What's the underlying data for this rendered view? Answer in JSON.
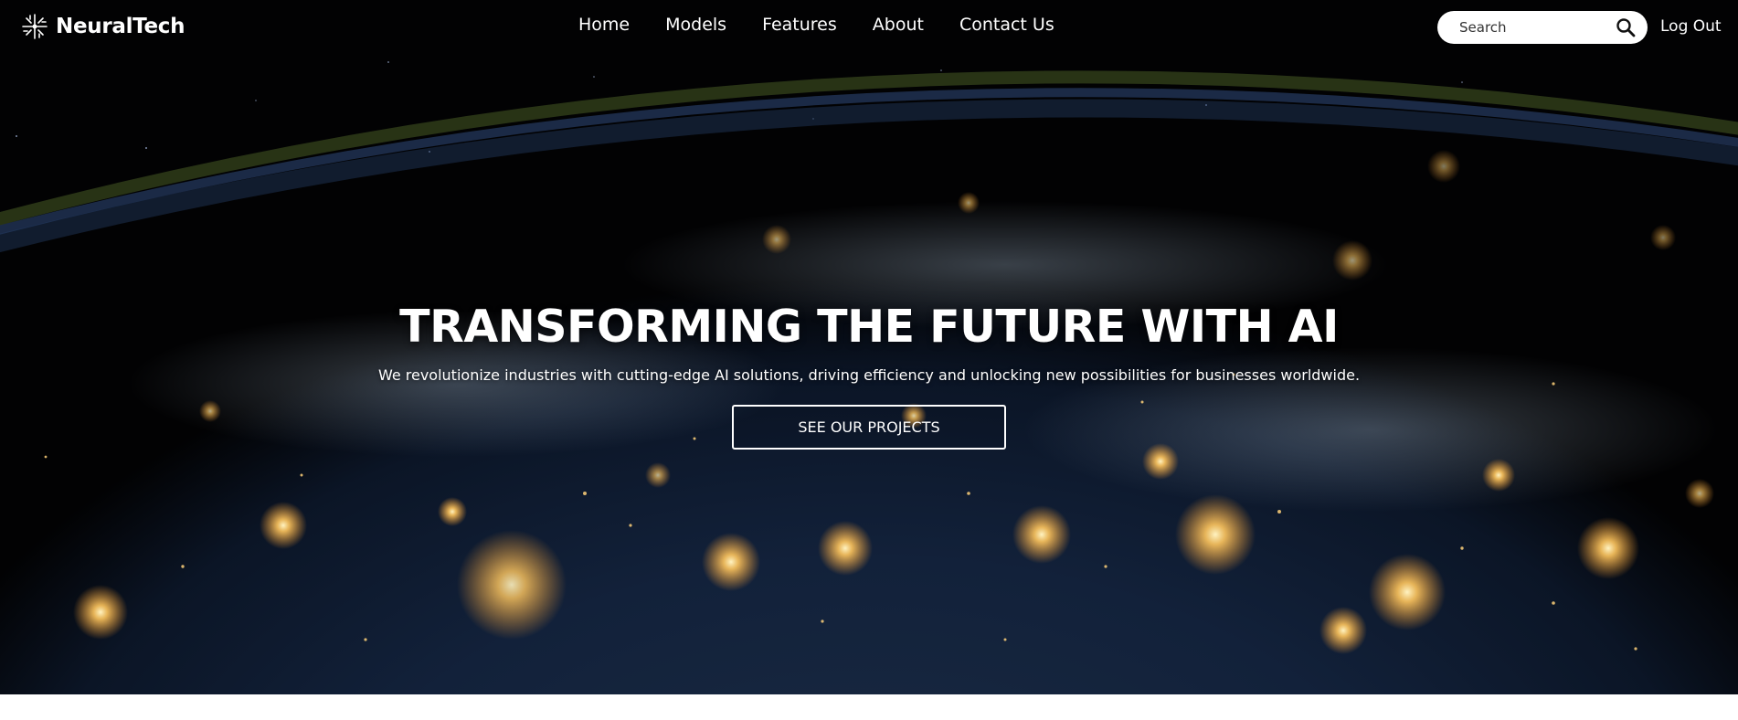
{
  "brand": {
    "name": "NeuralTech",
    "icon": "neural-network-icon"
  },
  "nav": {
    "items": [
      {
        "label": "Home"
      },
      {
        "label": "Models"
      },
      {
        "label": "Features"
      },
      {
        "label": "About"
      },
      {
        "label": "Contact Us"
      }
    ]
  },
  "search": {
    "placeholder": "Search",
    "value": "",
    "icon": "search-icon"
  },
  "auth": {
    "logout_label": "Log Out"
  },
  "hero": {
    "title": "TRANSFORMING THE FUTURE WITH AI",
    "subtitle": "We revolutionize industries with cutting-edge AI solutions, driving efficiency and unlocking new possibilities for businesses worldwide.",
    "cta_label": "SEE OUR PROJECTS",
    "background": "earth-at-night-from-space"
  },
  "colors": {
    "header_text": "#ffffff",
    "hero_dark": "#020203",
    "city_lights": "#ffc466",
    "page_background": "#ffffff"
  }
}
